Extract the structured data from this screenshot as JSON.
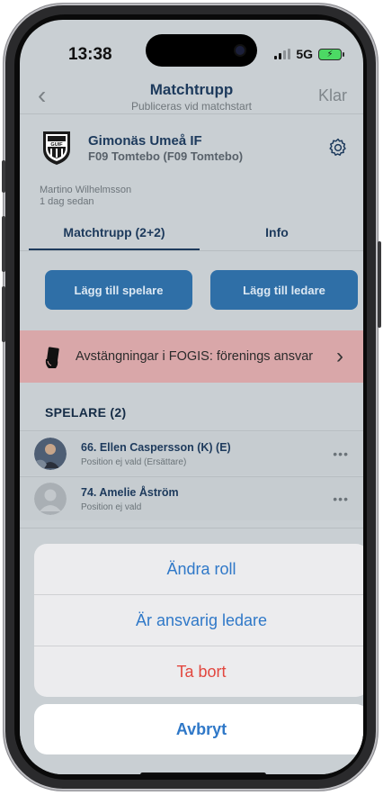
{
  "status_bar": {
    "time": "13:38",
    "network": "5G"
  },
  "nav": {
    "back_glyph": "‹",
    "title": "Matchtrupp",
    "subtitle": "Publiceras vid matchstart",
    "done_label": "Klar"
  },
  "team": {
    "club_name": "Gimonäs Umeå IF",
    "team_name": "F09 Tomtebo (F09 Tomtebo)",
    "logo_text": "GUIF"
  },
  "author": {
    "name": "Martino Wilhelmsson",
    "time": "1 dag sedan"
  },
  "tabs": [
    {
      "label": "Matchtrupp (2+2)",
      "active": true
    },
    {
      "label": "Info",
      "active": false
    }
  ],
  "actions": {
    "add_player": "Lägg till spelare",
    "add_leader": "Lägg till ledare"
  },
  "alert": {
    "text": "Avstängningar i FOGIS: förenings ansvar",
    "chevron": "›"
  },
  "players_section": {
    "header": "SPELARE (2)",
    "items": [
      {
        "name": "66. Ellen Caspersson (K) (E)",
        "position": "Position ej vald (Ersättare)",
        "more": "•••"
      },
      {
        "name": "74. Amelie Åström",
        "position": "Position ej vald",
        "more": "•••"
      }
    ]
  },
  "action_sheet": {
    "items": [
      {
        "label": "Ändra roll"
      },
      {
        "label": "Är ansvarig ledare"
      },
      {
        "label": "Ta bort"
      }
    ],
    "cancel": "Avbryt"
  },
  "colors": {
    "accent": "#2f78c8",
    "danger": "#e2473f",
    "primary_button": "#2f6fa7",
    "alert_background": "#d9a7a9"
  }
}
